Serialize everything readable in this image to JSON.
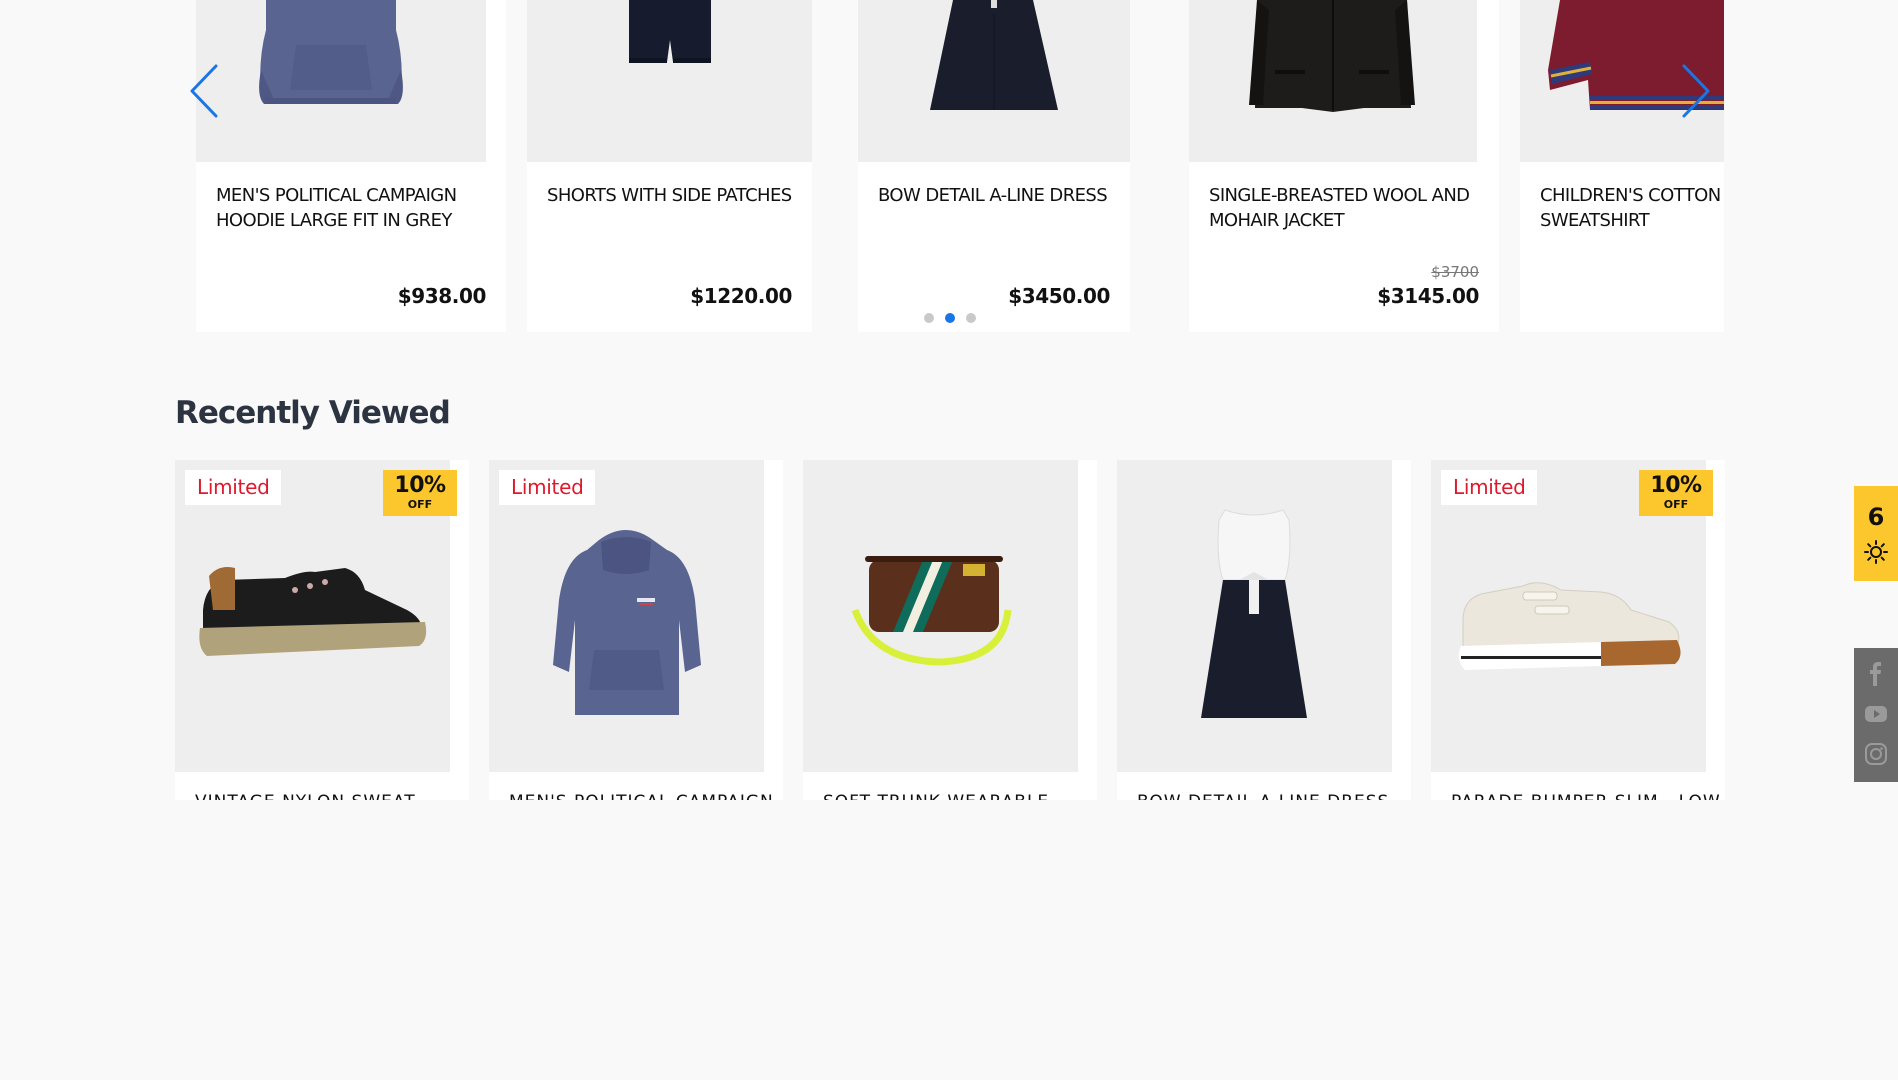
{
  "carousel": {
    "products": [
      {
        "name": "MEN'S POLITICAL CAMPAIGN HOODIE LARGE FIT IN GREY",
        "price": "$938.00",
        "old_price": ""
      },
      {
        "name": "SHORTS WITH SIDE PATCHES",
        "price": "$1220.00",
        "old_price": ""
      },
      {
        "name": "BOW DETAIL A-LINE DRESS",
        "price": "$3450.00",
        "old_price": ""
      },
      {
        "name": "SINGLE-BREASTED WOOL AND MOHAIR JACKET",
        "price": "$3145.00",
        "old_price": "$3700"
      },
      {
        "name": "CHILDREN'S COTTON SWEATSHIRT",
        "price": "",
        "old_price": ""
      }
    ],
    "active_dot": 2,
    "dot_count": 3
  },
  "recently_viewed": {
    "title": "Recently Viewed",
    "items": [
      {
        "badge": "Limited",
        "discount": "10%",
        "discount_label": "OFF",
        "name": "VINTAGE NYLON SWEAT",
        "icon": "sneaker-black-image"
      },
      {
        "badge": "Limited",
        "discount": "",
        "discount_label": "",
        "name": "MEN'S POLITICAL CAMPAIGN",
        "icon": "hoodie-image"
      },
      {
        "badge": "",
        "discount": "",
        "discount_label": "",
        "name": "SOFT TRUNK WEARABLE",
        "icon": "bag-image"
      },
      {
        "badge": "",
        "discount": "",
        "discount_label": "",
        "name": "BOW DETAIL A-LINE DRESS",
        "icon": "dress-image"
      },
      {
        "badge": "Limited",
        "discount": "10%",
        "discount_label": "OFF",
        "name": "PARADE BUMPER SLIM - LOW",
        "icon": "sneaker-white-image"
      }
    ]
  },
  "side_widget": {
    "cart_count": "6"
  },
  "colors": {
    "accent": "#1976e6",
    "badge_yellow": "#fcc62d",
    "limited_red": "#e0182b"
  }
}
